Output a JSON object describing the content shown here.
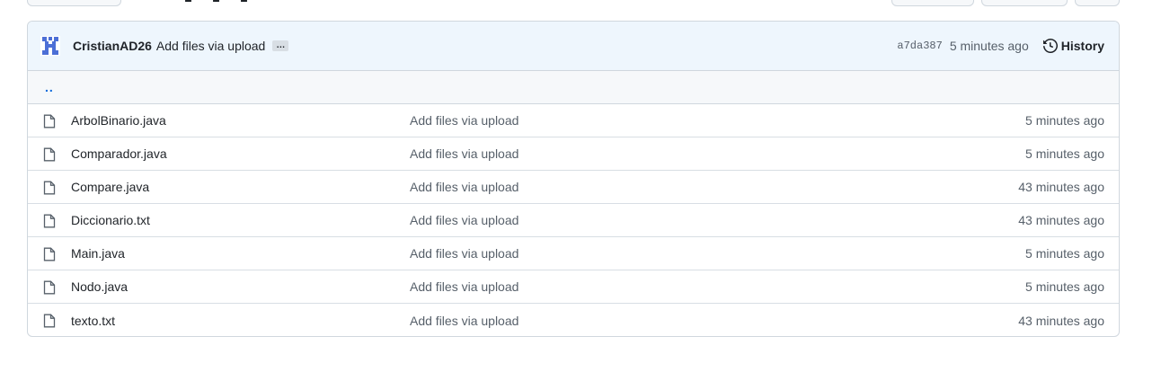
{
  "commit": {
    "author": "CristianAD26",
    "message": "Add files via upload",
    "ellipsis": "…",
    "sha": "a7da387",
    "time": "5 minutes ago",
    "history_label": "History"
  },
  "parent_link": "..",
  "files": [
    {
      "name": "ArbolBinario.java",
      "message": "Add files via upload",
      "time": "5 minutes ago"
    },
    {
      "name": "Comparador.java",
      "message": "Add files via upload",
      "time": "5 minutes ago"
    },
    {
      "name": "Compare.java",
      "message": "Add files via upload",
      "time": "43 minutes ago"
    },
    {
      "name": "Diccionario.txt",
      "message": "Add files via upload",
      "time": "43 minutes ago"
    },
    {
      "name": "Main.java",
      "message": "Add files via upload",
      "time": "5 minutes ago"
    },
    {
      "name": "Nodo.java",
      "message": "Add files via upload",
      "time": "5 minutes ago"
    },
    {
      "name": "texto.txt",
      "message": "Add files via upload",
      "time": "43 minutes ago"
    }
  ],
  "colors": {
    "link": "#0969da",
    "muted": "#57606a",
    "border": "#d0d7de",
    "commit_bar": "#eef6fd",
    "avatar": "#4c6fd6"
  }
}
